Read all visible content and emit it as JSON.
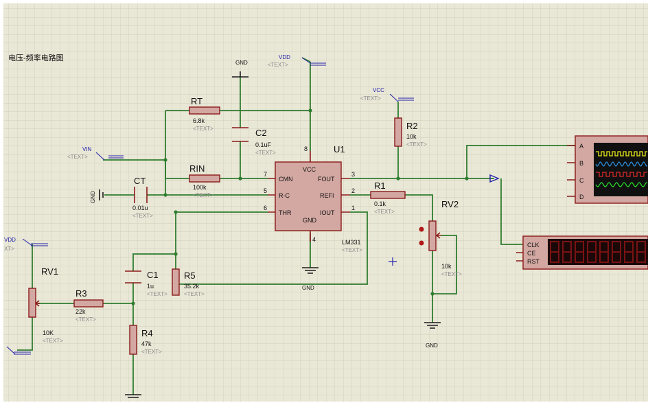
{
  "sheet": {
    "title": "电压-频率电路图"
  },
  "terminals": {
    "gnd_top": "GND",
    "vdd_top": "VDD",
    "vdd_top_text": "<TEXT>",
    "vcc": "VCC",
    "vcc_text": "<TEXT>",
    "vin": "VIN",
    "vin_text": "<TEXT>",
    "gnd_left": "GND",
    "vdd_left": "VDD",
    "vdd_left_text": "XT>",
    "gnd_u1": "GND",
    "gnd_rv2": "GND"
  },
  "components": {
    "rt": {
      "ref": "RT",
      "value": "6.8k",
      "text": "<TEXT>"
    },
    "c2": {
      "ref": "C2",
      "value": "0.1uF",
      "text": "<TEXT>"
    },
    "rin": {
      "ref": "RIN",
      "value": "100k",
      "text": "<TEXT>"
    },
    "ct": {
      "ref": "CT",
      "value": "0.01u",
      "text": "<TEXT>"
    },
    "u1": {
      "ref": "U1",
      "value": "LM331",
      "text": "<TEXT>"
    },
    "r2": {
      "ref": "R2",
      "value": "10k",
      "text": "<TEXT>"
    },
    "r1": {
      "ref": "R1",
      "value": "0.1k",
      "text": "<TEXT>"
    },
    "rv2": {
      "ref": "RV2",
      "value": "10k",
      "text": "<TEXT>"
    },
    "rv1": {
      "ref": "RV1",
      "value": "10K",
      "text": "<TEXT>"
    },
    "r3": {
      "ref": "R3",
      "value": "22k",
      "text": "<TEXT>"
    },
    "c1": {
      "ref": "C1",
      "value": "1u",
      "text": "<TEXT>"
    },
    "r5": {
      "ref": "R5",
      "value": "35.2k",
      "text": "<TEXT>"
    },
    "r4": {
      "ref": "R4",
      "value": "47k",
      "text": "<TEXT>"
    }
  },
  "u1_pins": {
    "vcc": "VCC",
    "cmn": "CMN",
    "rc": "R-C",
    "thr": "THR",
    "gnd": "GND",
    "fout": "FOUT",
    "refi": "REFI",
    "iout": "IOUT",
    "n8": "8",
    "n7": "7",
    "n5": "5",
    "n6": "6",
    "n4": "4",
    "n3": "3",
    "n2": "2",
    "n1": "1"
  },
  "scope": {
    "channels": [
      "A",
      "B",
      "C",
      "D"
    ],
    "trace_colors": [
      "#e8e81a",
      "#2a8bd8",
      "#d82a2a",
      "#2ad82a"
    ]
  },
  "counter": {
    "pins": [
      "CLK",
      "CE",
      "RST"
    ]
  }
}
